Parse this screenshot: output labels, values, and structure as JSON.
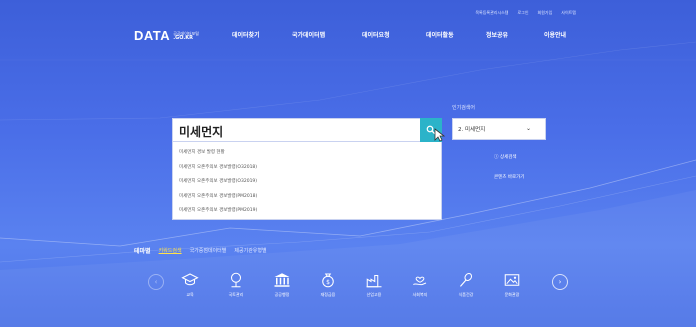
{
  "header": {
    "util_links": [
      "목록등록관리시스템",
      "로그인",
      "회원가입",
      "사이트맵"
    ],
    "logo": {
      "main": "DATA",
      "sub_top": "공공데이터포털",
      "sub_domain": ".GO.KR"
    },
    "nav": [
      "데이터찾기",
      "국가데이터맵",
      "데이터요청",
      "데이터활동",
      "정보공유",
      "이용안내"
    ]
  },
  "search": {
    "value": "미세먼지",
    "button_icon": "search-icon",
    "suggestions": [
      "미세먼지 경보 발령 현황",
      "미세먼지 오존주의보 경보발령(O32018)",
      "미세먼지 오존주의보 경보발령(O32019)",
      "미세먼지 오존주의보 경보발령(PM2018)",
      "미세먼지 오존주의보 경보발령(PM2019)"
    ]
  },
  "popular": {
    "label": "인기검색어",
    "selected": "2. 미세먼지",
    "detail_search": "상세검색",
    "content_shortcut": "콘텐츠 바로가기"
  },
  "theme": {
    "title": "테마별",
    "tabs": [
      "키워드검색",
      "국가중점데이터별",
      "제공기관유형별"
    ],
    "active_tab": 0
  },
  "categories": [
    {
      "label": "교육",
      "icon": "graduation-cap-icon"
    },
    {
      "label": "국토관리",
      "icon": "tree-icon"
    },
    {
      "label": "공공행정",
      "icon": "government-building-icon"
    },
    {
      "label": "재정금융",
      "icon": "money-bag-icon"
    },
    {
      "label": "산업고용",
      "icon": "factory-icon"
    },
    {
      "label": "사회복지",
      "icon": "hand-heart-icon"
    },
    {
      "label": "식품건강",
      "icon": "spoon-icon"
    },
    {
      "label": "문화관광",
      "icon": "picture-frame-icon"
    }
  ],
  "colors": {
    "accent": "#2bb3c9",
    "active_tab": "#ffe14b",
    "background": "#4a6ee8"
  }
}
